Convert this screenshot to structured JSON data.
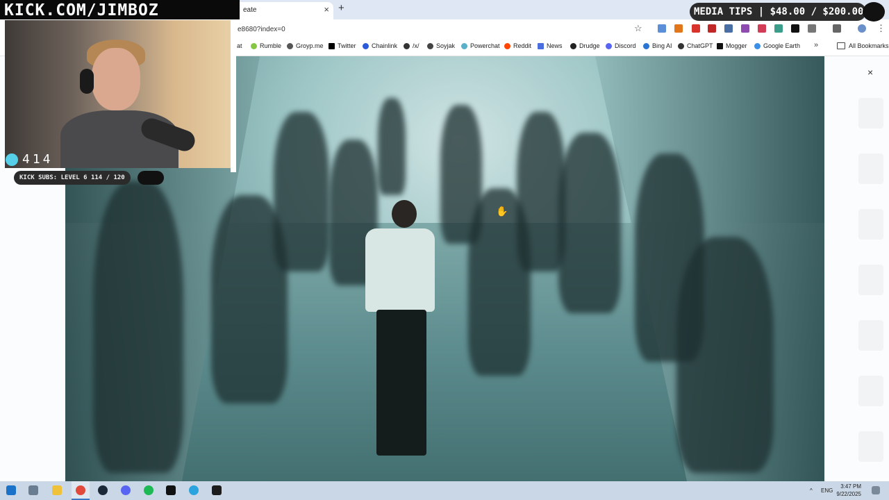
{
  "browser": {
    "tab_title": "eate",
    "tab_close": "×",
    "new_tab": "+",
    "url": "e8680?index=0",
    "star": "☆",
    "menu": "⋮"
  },
  "bookmarks": {
    "items": [
      {
        "label": "at",
        "color": "#888888"
      },
      {
        "label": "Rumble",
        "color": "#85c742"
      },
      {
        "label": "Groyp.me",
        "color": "#555555"
      },
      {
        "label": "Twitter",
        "color": "#000000"
      },
      {
        "label": "Chainlink",
        "color": "#2a5ada"
      },
      {
        "label": "/x/",
        "color": "#333333"
      },
      {
        "label": "Soyjak",
        "color": "#444444"
      },
      {
        "label": "Powerchat",
        "color": "#5ab0c8"
      },
      {
        "label": "Reddit",
        "color": "#ff4500"
      },
      {
        "label": "News",
        "color": "#4a6ee0"
      },
      {
        "label": "Drudge",
        "color": "#222222"
      },
      {
        "label": "Discord",
        "color": "#5865f2"
      },
      {
        "label": "Bing AI",
        "color": "#2a74d4"
      },
      {
        "label": "ChatGPT",
        "color": "#333333"
      },
      {
        "label": "Mogger",
        "color": "#111111"
      },
      {
        "label": "Google Earth",
        "color": "#3a8ee6"
      }
    ],
    "overflow": "»",
    "all_bookmarks": "All Bookmarks"
  },
  "overlay": {
    "close": "×"
  },
  "stream": {
    "banner": "KICK.COM/JIMBOZ",
    "viewers": "414",
    "subs": "KICK SUBS: LEVEL 6 114 / 120",
    "tips": "MEDIA TIPS | $48.00 / $200.00"
  },
  "taskbar": {
    "lang": "ENG",
    "time": "3:47 PM",
    "date": "9/22/2025",
    "tray_arrow": "^"
  }
}
